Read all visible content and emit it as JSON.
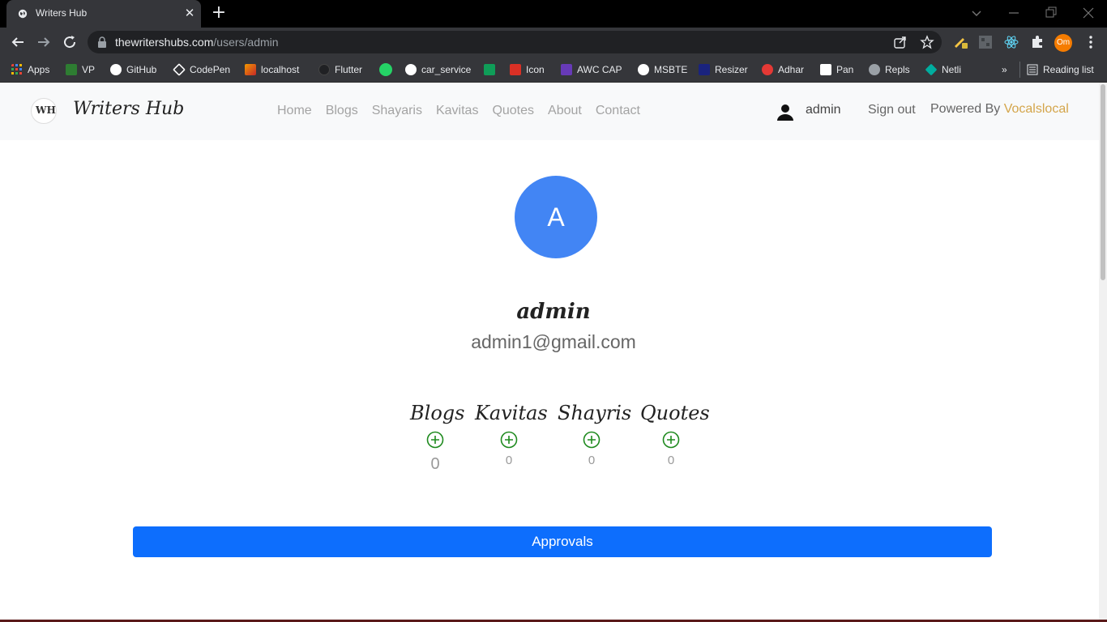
{
  "browser": {
    "tab_title": "Writers Hub",
    "new_tab_label": "+",
    "url_host": "thewritershubs.com",
    "url_path": "/users/admin",
    "profile_initials": "Om",
    "bookmarks": [
      {
        "label": "Apps",
        "icon": "apps-grid-icon",
        "color": "#ea4335"
      },
      {
        "label": "VP",
        "icon": "vp-icon",
        "color": "#34a853"
      },
      {
        "label": "GitHub",
        "icon": "github-icon",
        "color": "#ffffff"
      },
      {
        "label": "CodePen",
        "icon": "codepen-icon",
        "color": "#ffffff"
      },
      {
        "label": "localhost",
        "icon": "localhost-icon",
        "color": "#f29900"
      },
      {
        "label": "Flutter",
        "icon": "flutter-icon",
        "color": "#202124"
      },
      {
        "label": "",
        "icon": "whatsapp-icon",
        "color": "#25d366"
      },
      {
        "label": "car_service",
        "icon": "github-icon",
        "color": "#ffffff"
      },
      {
        "label": "",
        "icon": "green-app-icon",
        "color": "#0f9d58"
      },
      {
        "label": "Icon",
        "icon": "icon-grid-icon",
        "color": "#d93025"
      },
      {
        "label": "AWC CAP",
        "icon": "awc-icon",
        "color": "#673ab7"
      },
      {
        "label": "MSBTE",
        "icon": "msbte-icon",
        "color": "#ffffff"
      },
      {
        "label": "Resizer",
        "icon": "pdf-resizer-icon",
        "color": "#1a237e"
      },
      {
        "label": "Adhar",
        "icon": "adhar-icon",
        "color": "#e53935"
      },
      {
        "label": "Pan",
        "icon": "pan-icon",
        "color": "#ffffff"
      },
      {
        "label": "Repls",
        "icon": "replit-icon",
        "color": "#9aa0a6"
      },
      {
        "label": "Netli",
        "icon": "netlify-icon",
        "color": "#00ad9f"
      }
    ],
    "overflow_label": "»",
    "reading_list_label": "Reading list"
  },
  "site": {
    "logo_text": "WH",
    "brand": "Writers Hub",
    "menu": [
      "Home",
      "Blogs",
      "Shayaris",
      "Kavitas",
      "Quotes",
      "About",
      "Contact"
    ],
    "user_name": "admin",
    "sign_out": "Sign out",
    "powered_prefix": "Powered By ",
    "powered_brand": "Vocalslocal"
  },
  "profile": {
    "avatar_initial": "A",
    "name": "admin",
    "email": "admin1@gmail.com",
    "stats": [
      {
        "title": "Blogs",
        "count": "0"
      },
      {
        "title": "Kavitas",
        "count": "0"
      },
      {
        "title": "Shayris",
        "count": "0"
      },
      {
        "title": "Quotes",
        "count": "0"
      }
    ],
    "approvals_label": "Approvals"
  },
  "colors": {
    "avatar_bg": "#4285f4",
    "primary_button": "#0d6efd",
    "powered_brand": "#d4a54a",
    "add_icon": "#1e8a1e"
  }
}
